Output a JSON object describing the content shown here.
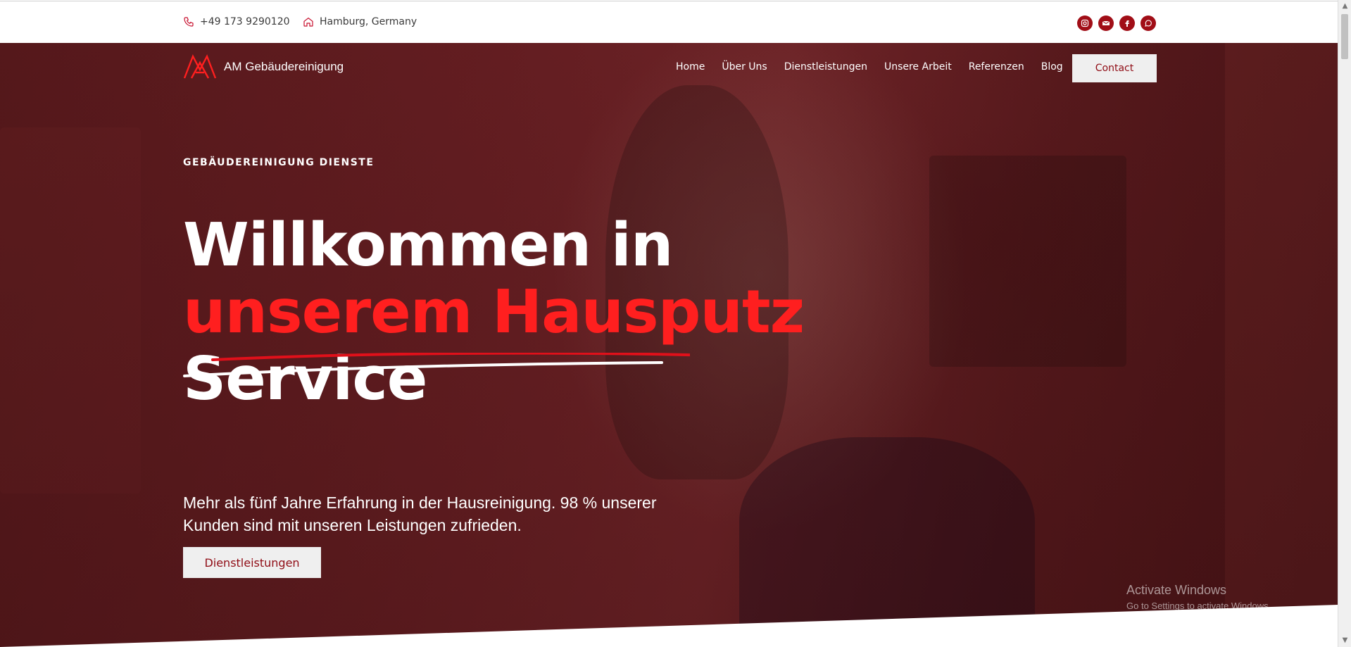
{
  "topbar": {
    "phone": "+49 173 9290120",
    "location": "Hamburg, Germany",
    "socials": [
      "instagram-icon",
      "email-icon",
      "facebook-icon",
      "whatsapp-icon"
    ]
  },
  "brand": {
    "name": "AM Gebäudereinigung",
    "logo_text": "AM"
  },
  "nav": {
    "items": [
      "Home",
      "Über Uns",
      "Dienstleistungen",
      "Unsere Arbeit",
      "Referenzen",
      "Blog"
    ],
    "contact": "Contact"
  },
  "hero": {
    "eyebrow": "GEBÄUDEREINIGUNG DIENSTE",
    "headline_line1": "Willkommen in",
    "headline_line2": "unserem Hausputz",
    "headline_line3": "Service",
    "subtitle": "Mehr als fünf Jahre Erfahrung in der Hausreinigung. 98 % unserer Kunden sind mit unseren Leistungen zufrieden.",
    "cta": "Dienstleistungen"
  },
  "watermark": {
    "title": "Activate Windows",
    "subtitle": "Go to Settings to activate Windows."
  },
  "colors": {
    "accent": "#ff1f1f",
    "brand_dark": "#8f0b14",
    "social_bg": "#a10e17",
    "hero_overlay": "#6a2024"
  }
}
